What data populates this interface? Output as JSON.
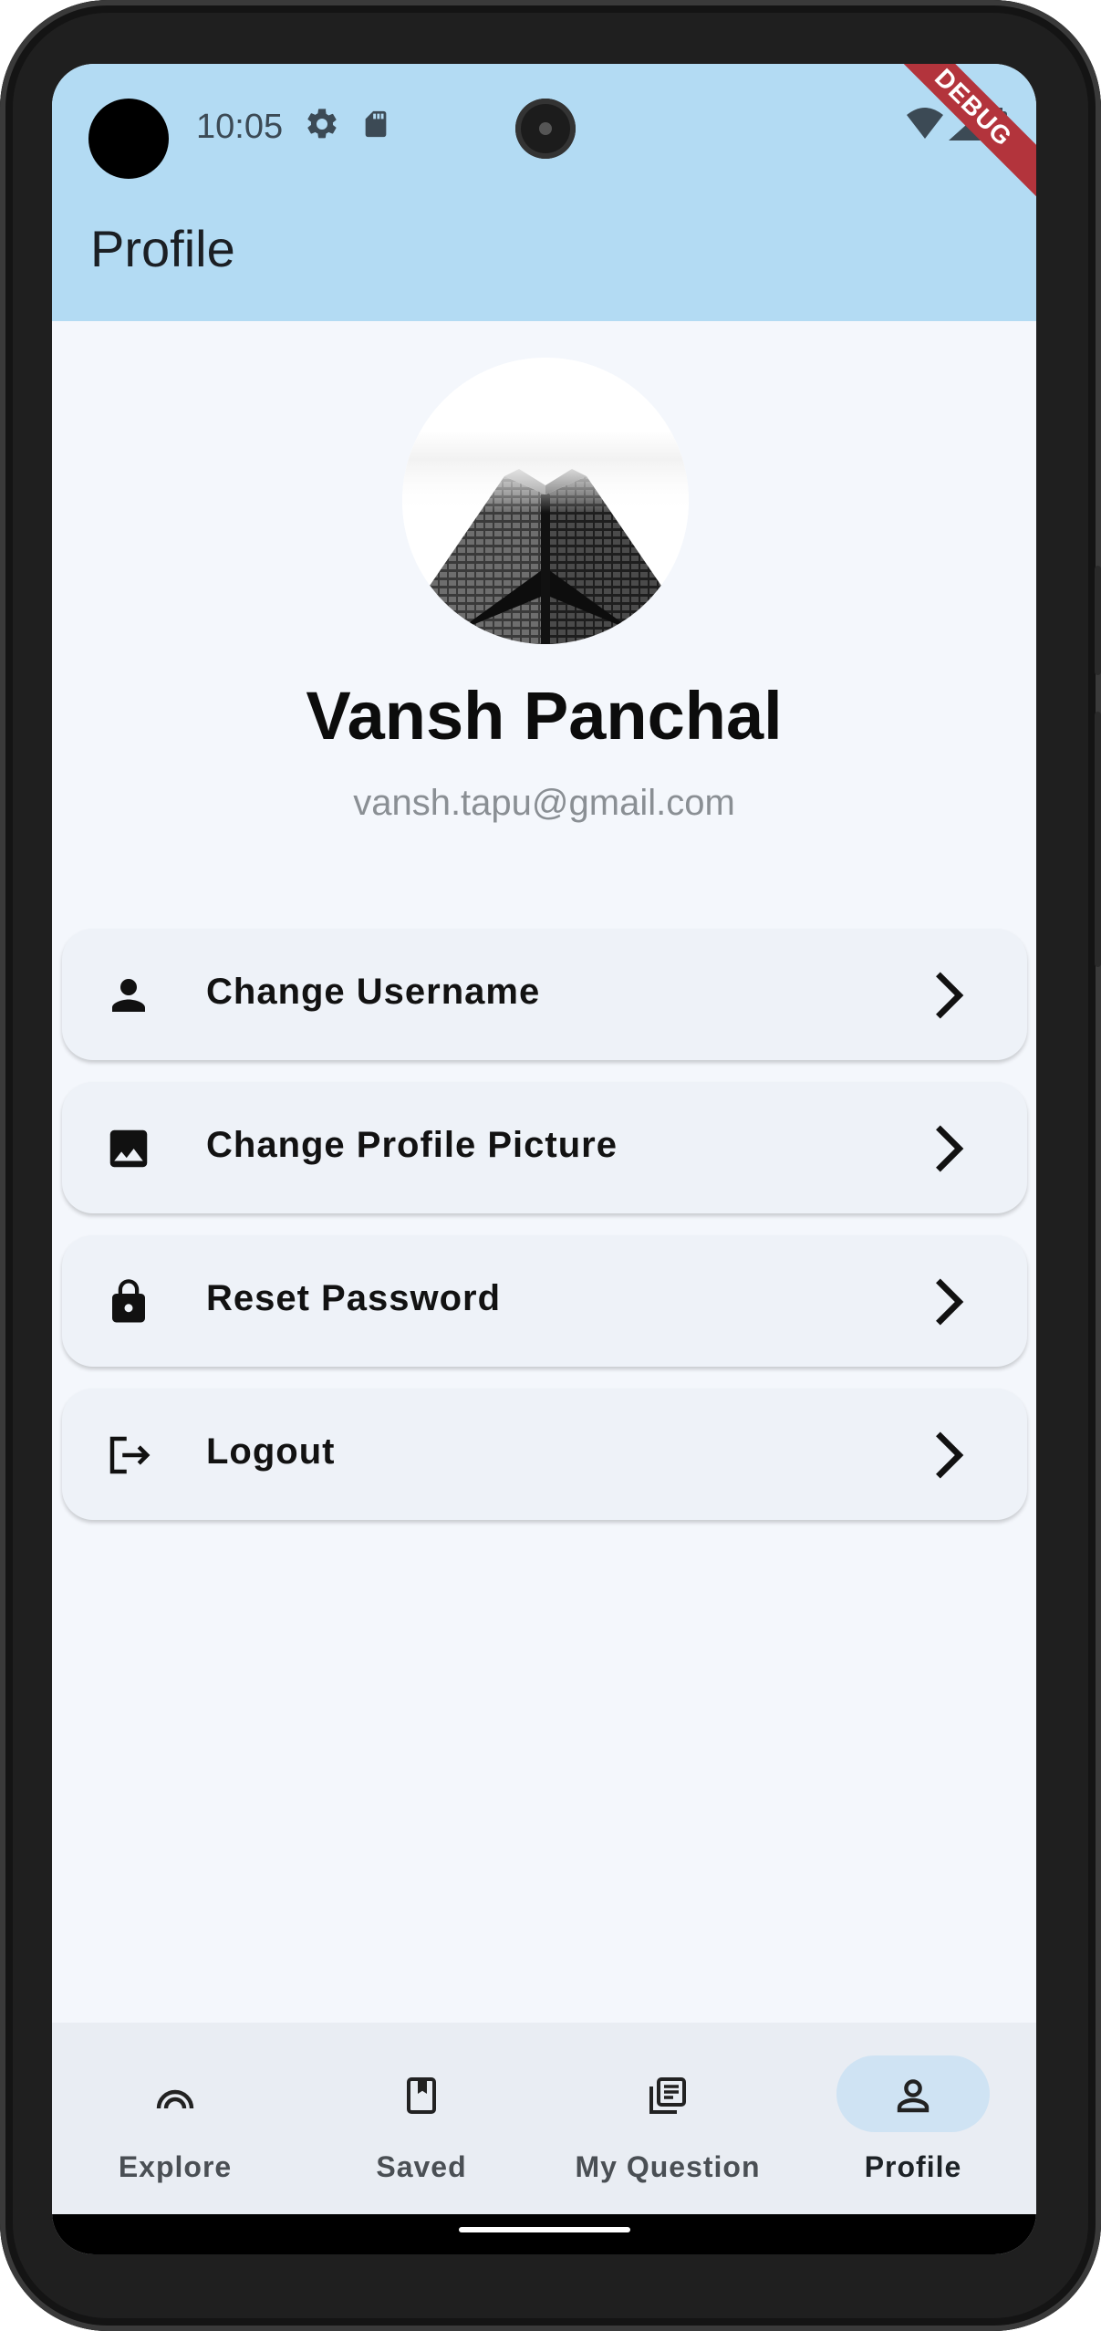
{
  "status_bar": {
    "time": "10:05",
    "debug_label": "DEBUG",
    "icons": [
      "settings-icon",
      "sd-card-icon",
      "wifi-icon",
      "signal-icon",
      "battery-icon"
    ]
  },
  "app_bar": {
    "title": "Profile",
    "background": "#b3dbf3"
  },
  "profile": {
    "name": "Vansh Panchal",
    "email": "vansh.tapu@gmail.com",
    "avatar_icon": "skyscraper-photo"
  },
  "menu": [
    {
      "icon": "person-icon",
      "label": "Change Username"
    },
    {
      "icon": "image-icon",
      "label": "Change Profile Picture"
    },
    {
      "icon": "lock-icon",
      "label": "Reset Password"
    },
    {
      "icon": "logout-icon",
      "label": "Logout"
    }
  ],
  "bottom_nav": {
    "items": [
      {
        "icon": "explore-icon",
        "label": "Explore",
        "active": false
      },
      {
        "icon": "bookmark-icon",
        "label": "Saved",
        "active": false
      },
      {
        "icon": "article-icon",
        "label": "My Question",
        "active": false
      },
      {
        "icon": "person-outline-icon",
        "label": "Profile",
        "active": true
      }
    ],
    "active_color": "#cfe3f3"
  }
}
